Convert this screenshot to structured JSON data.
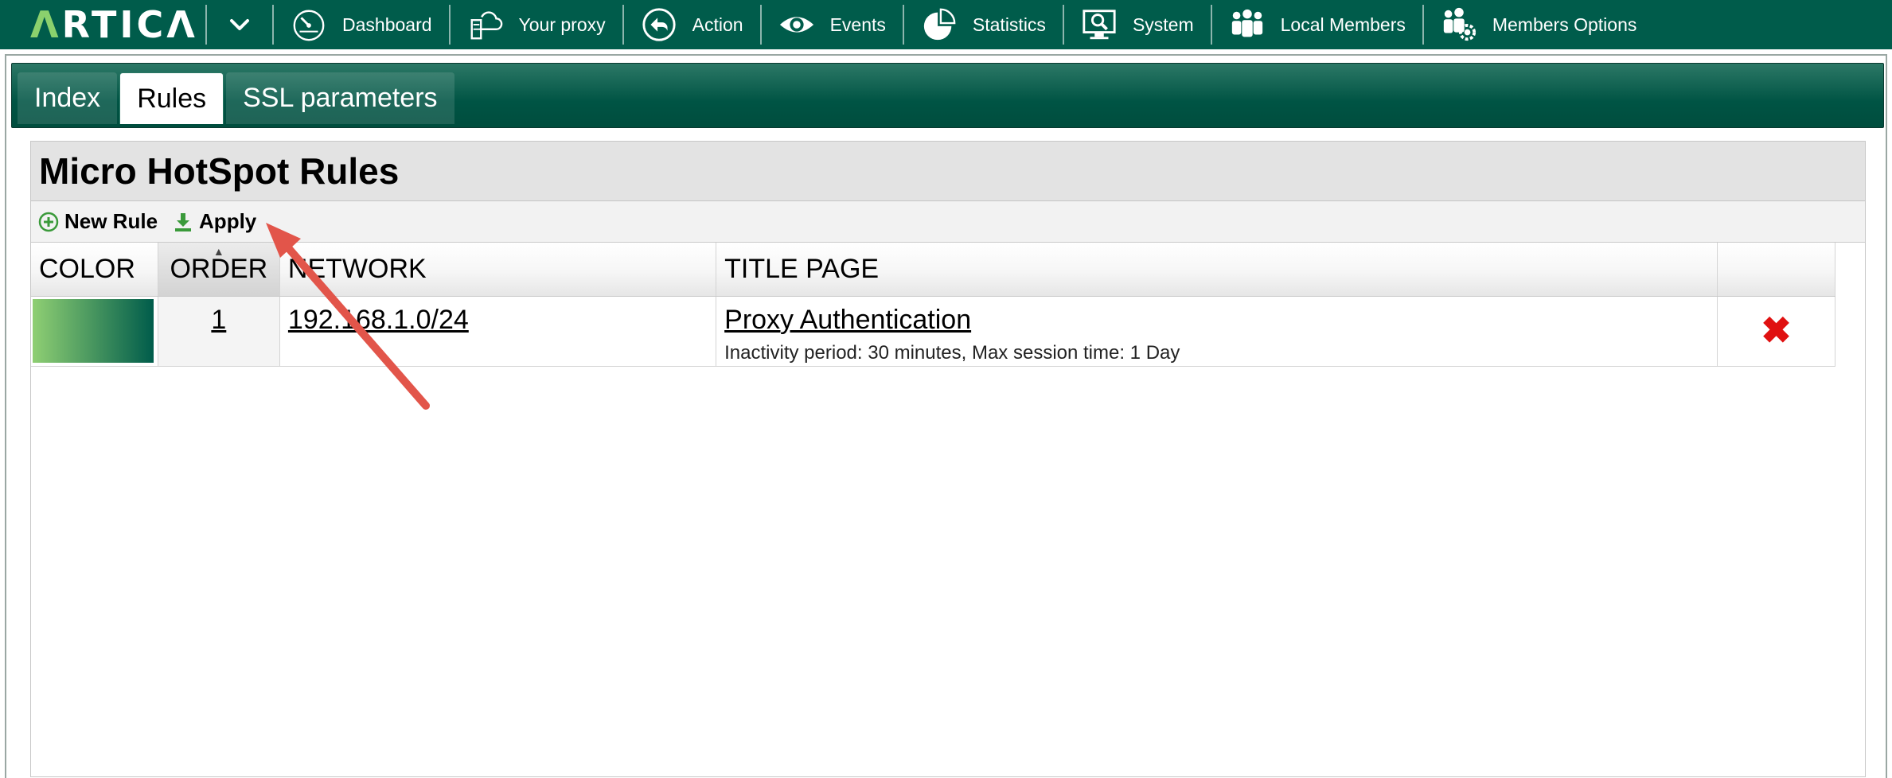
{
  "app": {
    "logo_first": "Λ",
    "logo_rest": "RTICΛ",
    "nav": [
      {
        "label": "Dashboard",
        "icon": "speedometer-icon"
      },
      {
        "label": "Your proxy",
        "icon": "cloud-server-icon"
      },
      {
        "label": "Action",
        "icon": "back-arrow-icon"
      },
      {
        "label": "Events",
        "icon": "eye-icon"
      },
      {
        "label": "Statistics",
        "icon": "pie-chart-icon"
      },
      {
        "label": "System",
        "icon": "monitor-search-icon"
      },
      {
        "label": "Local Members",
        "icon": "users-icon"
      },
      {
        "label": "Members Options",
        "icon": "users-gear-icon"
      }
    ]
  },
  "tabs": [
    {
      "label": "Index",
      "active": false
    },
    {
      "label": "Rules",
      "active": true
    },
    {
      "label": "SSL parameters",
      "active": false
    }
  ],
  "panel": {
    "title": "Micro HotSpot Rules",
    "toolbar": {
      "new_rule": "New Rule",
      "apply": "Apply"
    },
    "columns": [
      "COLOR",
      "ORDER",
      "NETWORK",
      "TITLE PAGE",
      ""
    ],
    "rows": [
      {
        "color_gradient": [
          "#8fcf73",
          "#005c4b"
        ],
        "order": "1",
        "network": "192.168.1.0/24",
        "title_page": "Proxy Authentication",
        "title_detail": "Inactivity period: 30 minutes, Max session time: 1 Day",
        "delete_icon": "delete-x-icon"
      }
    ]
  },
  "colors": {
    "brand": "#005c4b",
    "logo_accent": "#8bd16d",
    "delete": "#e01010",
    "annotation_arrow": "#e2554a"
  }
}
